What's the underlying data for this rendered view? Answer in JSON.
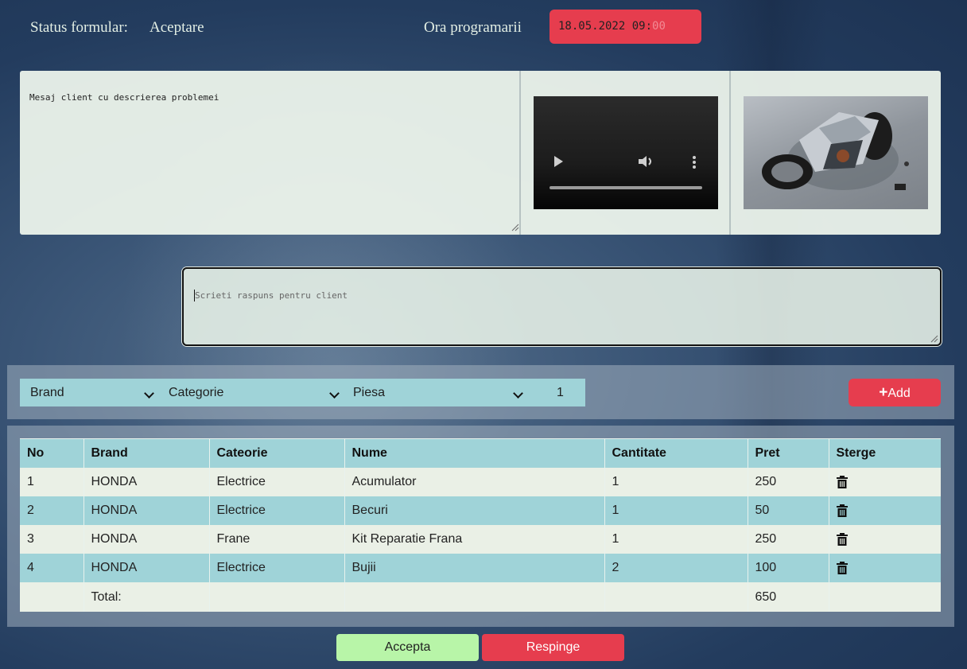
{
  "header": {
    "status_label": "Status formular:",
    "status_value": "Aceptare",
    "ora_label": "Ora programarii",
    "date_main": "18.05.2022 09:",
    "date_dim": "00"
  },
  "message": {
    "text": "Mesaj client cu descrierea problemei"
  },
  "media": {
    "video_controls": [
      "play-icon",
      "volume-icon",
      "more-icon"
    ]
  },
  "reply": {
    "placeholder": "Scrieti raspuns pentru client"
  },
  "filters": {
    "brand": "Brand",
    "categorie": "Categorie",
    "piesa": "Piesa",
    "quantity": "1",
    "add_plus": "+",
    "add_label": "Add"
  },
  "table": {
    "headers": [
      "No",
      "Brand",
      "Cateorie",
      "Nume",
      "Cantitate",
      "Pret",
      "Sterge"
    ],
    "rows": [
      {
        "no": "1",
        "brand": "HONDA",
        "categorie": "Electrice",
        "nume": "Acumulator",
        "cantitate": "1",
        "pret": "250"
      },
      {
        "no": "2",
        "brand": "HONDA",
        "categorie": "Electrice",
        "nume": "Becuri",
        "cantitate": "1",
        "pret": "50"
      },
      {
        "no": "3",
        "brand": "HONDA",
        "categorie": "Frane",
        "nume": "Kit Reparatie Frana",
        "cantitate": "1",
        "pret": "250"
      },
      {
        "no": "4",
        "brand": "HONDA",
        "categorie": "Electrice",
        "nume": "Bujii",
        "cantitate": "2",
        "pret": "100"
      }
    ],
    "total_label": "Total:",
    "total_value": "650"
  },
  "actions": {
    "accept": "Accepta",
    "reject": "Respinge"
  },
  "colors": {
    "accent_red": "#e63d4e",
    "accent_teal": "#9fd3d8",
    "accept_green": "#b8f5a8"
  }
}
